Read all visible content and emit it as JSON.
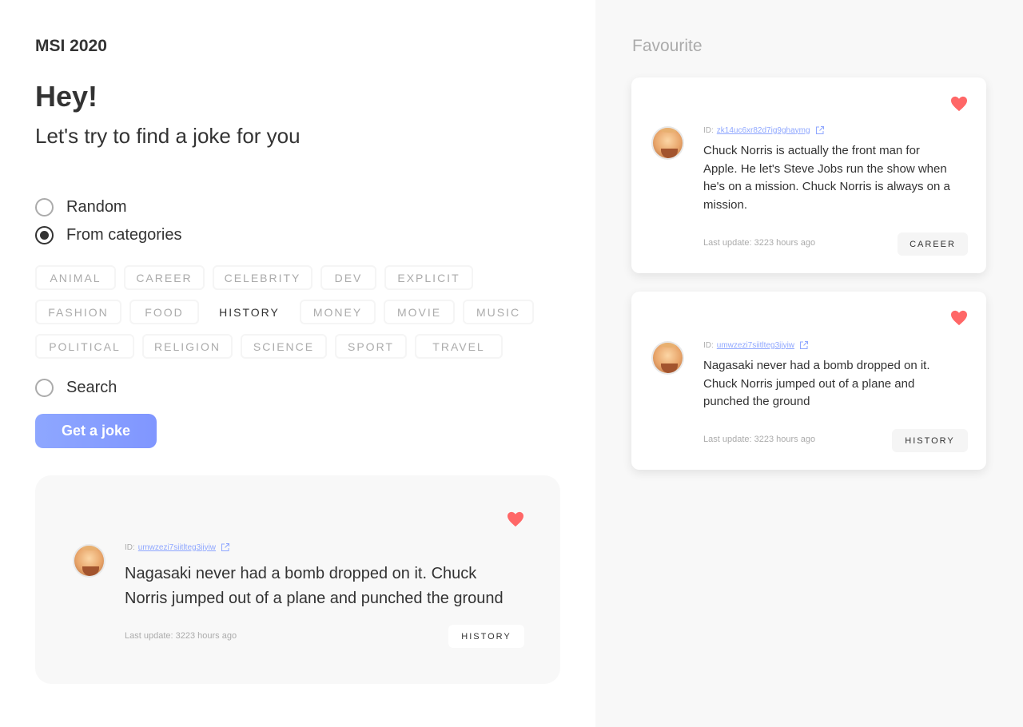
{
  "app": {
    "title": "MSI 2020"
  },
  "hero": {
    "greeting": "Hey!",
    "subtitle": "Let's try to find a joke for you"
  },
  "options": {
    "random": {
      "label": "Random",
      "checked": false
    },
    "from_categories": {
      "label": "From categories",
      "checked": true
    },
    "search": {
      "label": "Search",
      "checked": false
    }
  },
  "categories": {
    "selected": "HISTORY",
    "rows": [
      [
        "ANIMAL",
        "CAREER",
        "CELEBRITY",
        "DEV",
        "EXPLICIT"
      ],
      [
        "FASHION",
        "FOOD",
        "HISTORY",
        "MONEY",
        "MOVIE",
        "MUSIC"
      ],
      [
        "POLITICAL",
        "RELIGION",
        "SCIENCE",
        "SPORT",
        "TRAVEL"
      ]
    ]
  },
  "get_button": {
    "label": "Get a joke"
  },
  "current_joke": {
    "id_label": "ID:",
    "id": "umwzezi7siitlteg3jiyiw",
    "text_line1": "Nagasaki never had a bomb dropped on it. Chuck",
    "text_line2": "Norris jumped out of a plane and punched the ground",
    "updated": "Last update: 3223 hours ago",
    "category": "HISTORY",
    "favourite": true
  },
  "favourites": {
    "title": "Favourite",
    "items": [
      {
        "id_label": "ID:",
        "id": "zk14uc6xr82d7ig9ghaymg",
        "lines": [
          "Chuck Norris is actually the front man for",
          "Apple. He let's Steve Jobs run the show when",
          "he's on a mission. Chuck Norris is always on a",
          "mission."
        ],
        "updated": "Last update: 3223 hours ago",
        "category": "CAREER"
      },
      {
        "id_label": "ID:",
        "id": "umwzezi7siitlteg3jiyiw",
        "lines": [
          "Nagasaki never had a bomb dropped on it.",
          "Chuck Norris jumped out of a plane and",
          "punched the ground"
        ],
        "updated": "Last update: 3223 hours ago",
        "category": "HISTORY"
      }
    ]
  },
  "colors": {
    "accent": "#8ea7ff",
    "heart": "#ff6767",
    "text": "#333333",
    "muted": "#ababab",
    "panel": "#f8f8f8"
  },
  "icons": {
    "favourite": "heart-icon",
    "external": "external-link-icon",
    "avatar": "chuck-norris-avatar"
  }
}
